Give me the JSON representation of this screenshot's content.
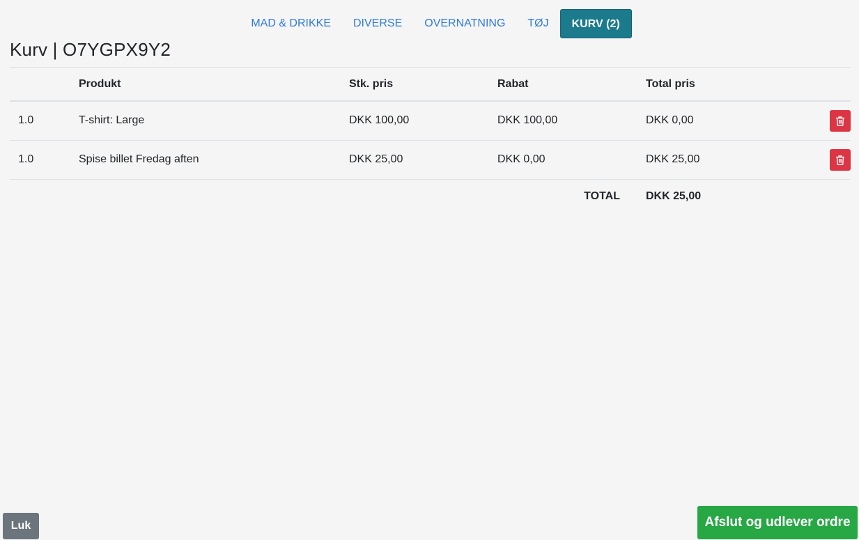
{
  "nav": {
    "items": [
      {
        "label": "MAD & DRIKKE"
      },
      {
        "label": "DIVERSE"
      },
      {
        "label": "OVERNATNING"
      },
      {
        "label": "TØJ"
      },
      {
        "label": "KURV (2)"
      }
    ],
    "active_index": 4
  },
  "page": {
    "title": "Kurv | O7YGPX9Y2"
  },
  "table": {
    "headers": {
      "qty": "",
      "product": "Produkt",
      "unit_price": "Stk. pris",
      "discount": "Rabat",
      "total_price": "Total pris"
    },
    "rows": [
      {
        "qty": "1.0",
        "product": "T-shirt: Large",
        "unit_price": "DKK 100,00",
        "discount": "DKK 100,00",
        "total_price": "DKK 0,00"
      },
      {
        "qty": "1.0",
        "product": "Spise billet Fredag aften",
        "unit_price": "DKK 25,00",
        "discount": "DKK 0,00",
        "total_price": "DKK 25,00"
      }
    ],
    "total_label": "TOTAL",
    "total_value": "DKK 25,00"
  },
  "footer": {
    "close_label": "Luk",
    "finish_label": "Afslut og udlever ordre"
  },
  "colors": {
    "active_tab": "#1b7a8c",
    "link": "#2f7bdb",
    "delete": "#dc3545",
    "close": "#6c757d",
    "finish": "#28a745"
  },
  "icons": {
    "delete": "trash-icon"
  }
}
